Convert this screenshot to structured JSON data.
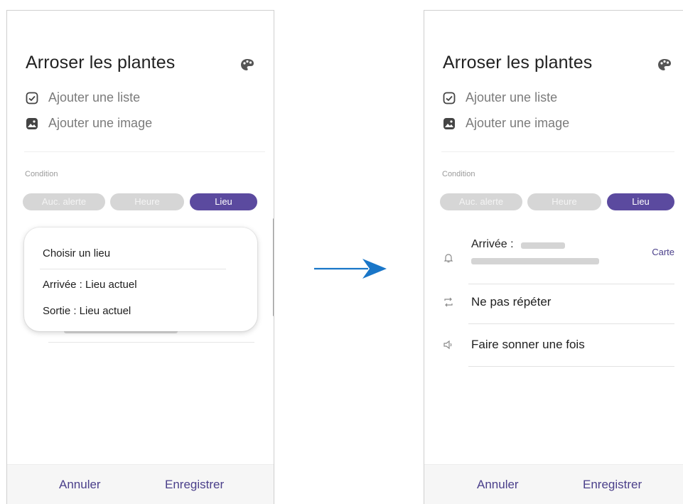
{
  "left_screen": {
    "title": "Arroser les plantes",
    "options": [
      "Ajouter une liste",
      "Ajouter une image"
    ],
    "condition_label": "Condition",
    "chips": [
      {
        "label": "Auc. alerte",
        "active": false
      },
      {
        "label": "Heure",
        "active": false
      },
      {
        "label": "Lieu",
        "active": true
      }
    ],
    "popup": {
      "title": "Choisir un lieu",
      "items": [
        "Arrivée : Lieu actuel",
        "Sortie : Lieu actuel"
      ]
    },
    "footer": {
      "cancel": "Annuler",
      "save": "Enregistrer"
    }
  },
  "right_screen": {
    "title": "Arroser les plantes",
    "options": [
      "Ajouter une liste",
      "Ajouter une image"
    ],
    "condition_label": "Condition",
    "chips": [
      {
        "label": "Auc. alerte",
        "active": false
      },
      {
        "label": "Heure",
        "active": false
      },
      {
        "label": "Lieu",
        "active": true
      }
    ],
    "arrival_label": "Arrivée :",
    "map_link": "Carte",
    "repeat_label": "Ne pas répéter",
    "sound_label": "Faire sonner une fois",
    "footer": {
      "cancel": "Annuler",
      "save": "Enregistrer"
    }
  },
  "colors": {
    "accent": "#5b4a9f",
    "chip_off": "#d6d6d6",
    "arrow": "#1976c8"
  }
}
